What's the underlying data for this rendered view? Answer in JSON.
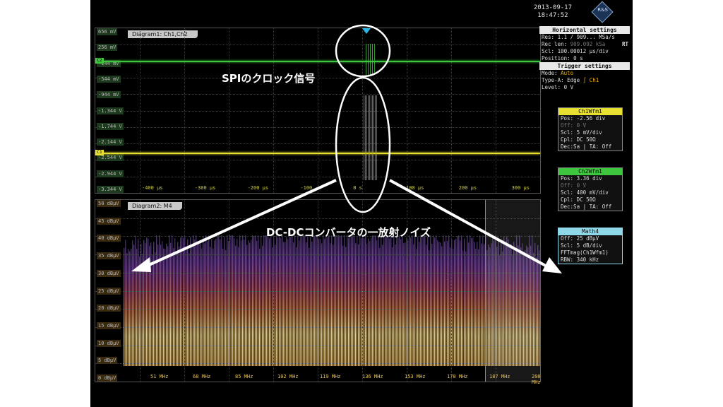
{
  "header": {
    "date": "2013-09-17",
    "time": "18:47:52",
    "logo": "R&S"
  },
  "diagram1": {
    "title": "Diagram1: Ch1,Ch2",
    "y_labels": [
      "656 mV",
      "256 mV",
      "-144 mV",
      "-544 mV",
      "-944 mV",
      "-1.344 V",
      "-1.744 V",
      "-2.144 V",
      "-2.544 V",
      "-2.944 V",
      "-3.344 V"
    ],
    "x_labels": [
      "-400 µs",
      "-300 µs",
      "-200 µs",
      "-100",
      "0 s",
      "100 µs",
      "200 µs",
      "300 µs"
    ],
    "ch2_marker": "C2",
    "ch1_marker": "C1"
  },
  "diagram2": {
    "title": "Diagram2: M4",
    "y_labels": [
      "50 dBµV",
      "45 dBµV",
      "40 dBµV",
      "35 dBµV",
      "30 dBµV",
      "25 dBµV",
      "20 dBµV",
      "15 dBµV",
      "10 dBµV",
      "5 dBµV",
      "0 dBµV"
    ],
    "x_labels": [
      "51 MHz",
      "68 MHz",
      "85 MHz",
      "102 MHz",
      "119 MHz",
      "136 MHz",
      "153 MHz",
      "170 MHz",
      "187 MHz",
      "200 MHz"
    ]
  },
  "horizontal": {
    "title": "Horizontal settings",
    "rows": [
      {
        "k": "Res:",
        "v": "1.1 / 909... MSa/s"
      },
      {
        "k": "Rec len:",
        "v": "909.092 kSa"
      },
      {
        "k": "Scl:",
        "v": "100.00012 µs/div"
      },
      {
        "k": "Position:",
        "v": "0 s"
      }
    ],
    "rt": "RT"
  },
  "trigger": {
    "title": "Trigger settings",
    "mode_k": "Mode:",
    "mode_v": "Auto",
    "type_k": "Type-A:",
    "type_v": "Edge",
    "type_src": "Ch1",
    "level_k": "Level:",
    "level_v": "0 V"
  },
  "ch1wfm": {
    "title": "Ch1Wfm1",
    "rows": [
      "Pos: -2.56 div",
      "Off: 0 V",
      "Scl: 5 mV/div",
      "Cpl: DC 50Ω",
      "Dec:Sa | TA: Off"
    ]
  },
  "ch2wfm": {
    "title": "Ch2Wfm1",
    "rows": [
      "Pos: 3.36 div",
      "Off: 0 V",
      "Scl: 400 mV/div",
      "Cpl: DC 50Ω",
      "Dec:Sa | TA: Off"
    ]
  },
  "math4": {
    "title": "Math4",
    "rows": [
      "Off: 25 dBµV",
      "Scl: 5 dB/div",
      "FFTmag(Ch1Wfm1)",
      "RBW: 340 kHz"
    ]
  },
  "annotations": {
    "spi": "SPIのクロック信号",
    "noise": "DC-DCコンバータの一放射ノイズ"
  },
  "colors": {
    "ch1": "#e8e030",
    "ch2": "#3ec63e",
    "math": "#8fd8e8",
    "spectrum_low": "#ffd24a",
    "spectrum_mid": "#ff6a1a",
    "spectrum_high": "#8a2be2"
  }
}
